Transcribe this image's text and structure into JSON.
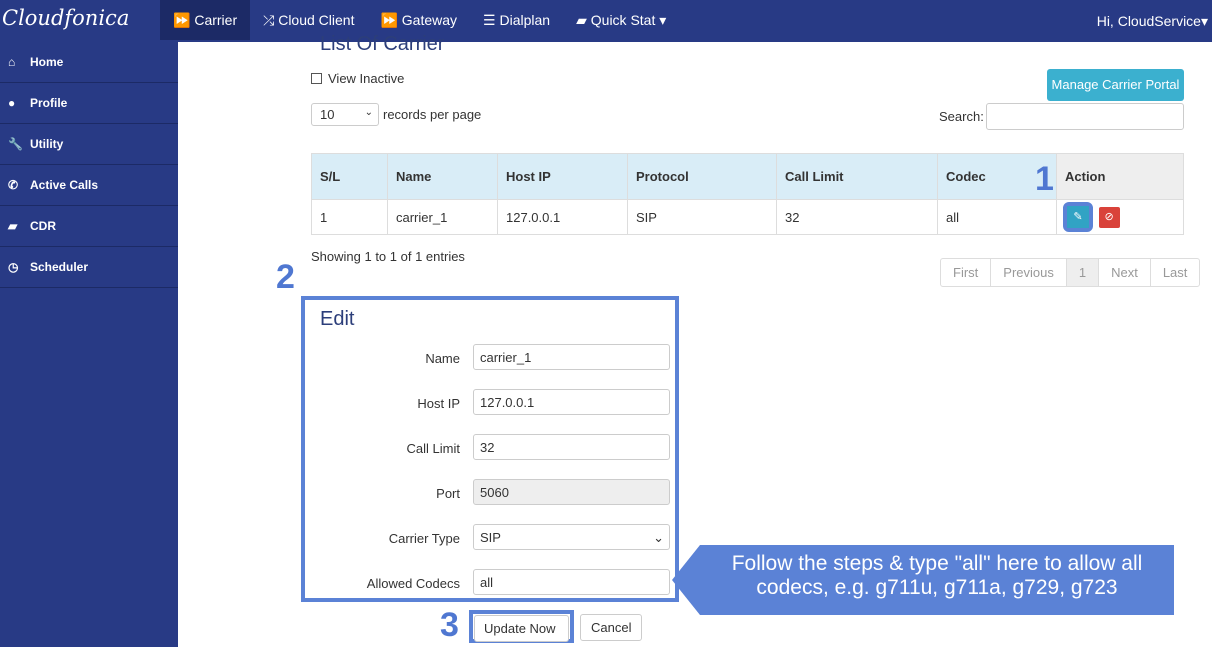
{
  "brand": "Cloudfonica",
  "nav": [
    {
      "icon": "forward-icon",
      "glyph": "⏩",
      "label": "Carrier"
    },
    {
      "icon": "shuffle-icon",
      "glyph": "⤮",
      "label": "Cloud Client"
    },
    {
      "icon": "forward-icon",
      "glyph": "⏩",
      "label": "Gateway"
    },
    {
      "icon": "list-icon",
      "glyph": "☰",
      "label": "Dialplan"
    },
    {
      "icon": "book-icon",
      "glyph": "▰",
      "label": "Quick Stat ▾"
    }
  ],
  "user": "Hi, CloudService▾",
  "sidebar": [
    {
      "icon": "home-icon",
      "glyph": "⌂",
      "label": "Home"
    },
    {
      "icon": "user-icon",
      "glyph": "●",
      "label": "Profile"
    },
    {
      "icon": "wrench-icon",
      "glyph": "🔧",
      "label": "Utility"
    },
    {
      "icon": "phone-icon",
      "glyph": "✆",
      "label": "Active Calls"
    },
    {
      "icon": "book-icon",
      "glyph": "▰",
      "label": "CDR"
    },
    {
      "icon": "clock-icon",
      "glyph": "◷",
      "label": "Scheduler"
    }
  ],
  "page_title": "List Of Carrier",
  "view_inactive": "View Inactive",
  "per_page": "10",
  "per_page_label": "records per page",
  "manage_btn": "Manage Carrier Portal",
  "search_label": "Search:",
  "columns": [
    "S/L",
    "Name",
    "Host IP",
    "Protocol",
    "Call Limit",
    "Codec",
    "Action"
  ],
  "rows": [
    [
      "1",
      "carrier_1",
      "127.0.0.1",
      "SIP",
      "32",
      "all"
    ]
  ],
  "showing": "Showing 1 to 1 of 1 entries",
  "pagination": [
    "First",
    "Previous",
    "1",
    "Next",
    "Last"
  ],
  "edit": {
    "title": "Edit",
    "fields": [
      {
        "label": "Name",
        "value": "carrier_1"
      },
      {
        "label": "Host IP",
        "value": "127.0.0.1"
      },
      {
        "label": "Call Limit",
        "value": "32"
      },
      {
        "label": "Port",
        "value": "5060"
      },
      {
        "label": "Carrier Type",
        "value": "SIP"
      },
      {
        "label": "Allowed Codecs",
        "value": "all"
      }
    ],
    "update": "Update Now",
    "cancel": "Cancel"
  },
  "steps": [
    "1",
    "2",
    "3"
  ],
  "callout": "Follow the steps & type \"all\" here to allow all codecs, e.g. g711u, g711a, g729, g723"
}
